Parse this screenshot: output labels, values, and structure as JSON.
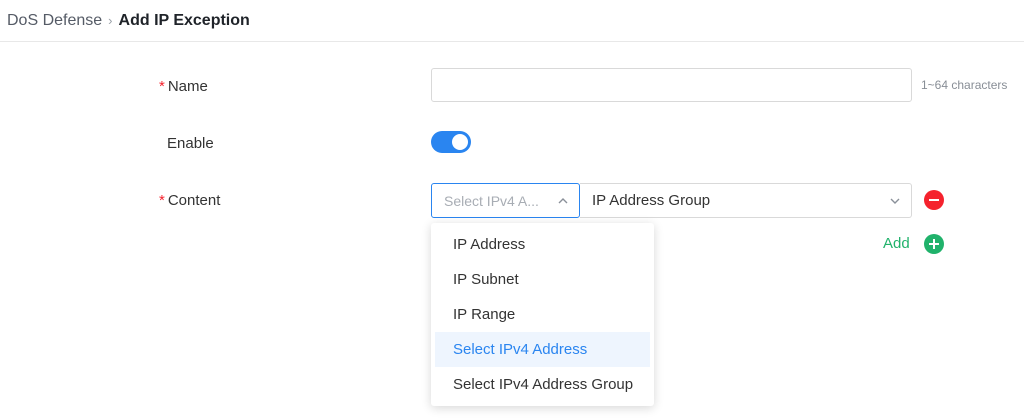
{
  "breadcrumb": {
    "parent": "DoS Defense",
    "separator": "›",
    "current": "Add IP Exception"
  },
  "form": {
    "name": {
      "required_mark": "*",
      "label": "Name",
      "value": "",
      "hint": "1~64 characters"
    },
    "enable": {
      "label": "Enable",
      "on": true
    },
    "content": {
      "required_mark": "*",
      "label": "Content",
      "type_select": {
        "placeholder": "Select IPv4 A...",
        "open": true
      },
      "value_select": {
        "value": "IP Address Group"
      },
      "add_label": "Add"
    }
  },
  "dropdown": {
    "options": [
      {
        "label": "IP Address",
        "active": false
      },
      {
        "label": "IP Subnet",
        "active": false
      },
      {
        "label": "IP Range",
        "active": false
      },
      {
        "label": "Select IPv4 Address",
        "active": true
      },
      {
        "label": "Select IPv4 Address Group",
        "active": false
      }
    ]
  },
  "colors": {
    "primary": "#2a85f0",
    "danger": "#f5222d",
    "success": "#20b26b"
  }
}
